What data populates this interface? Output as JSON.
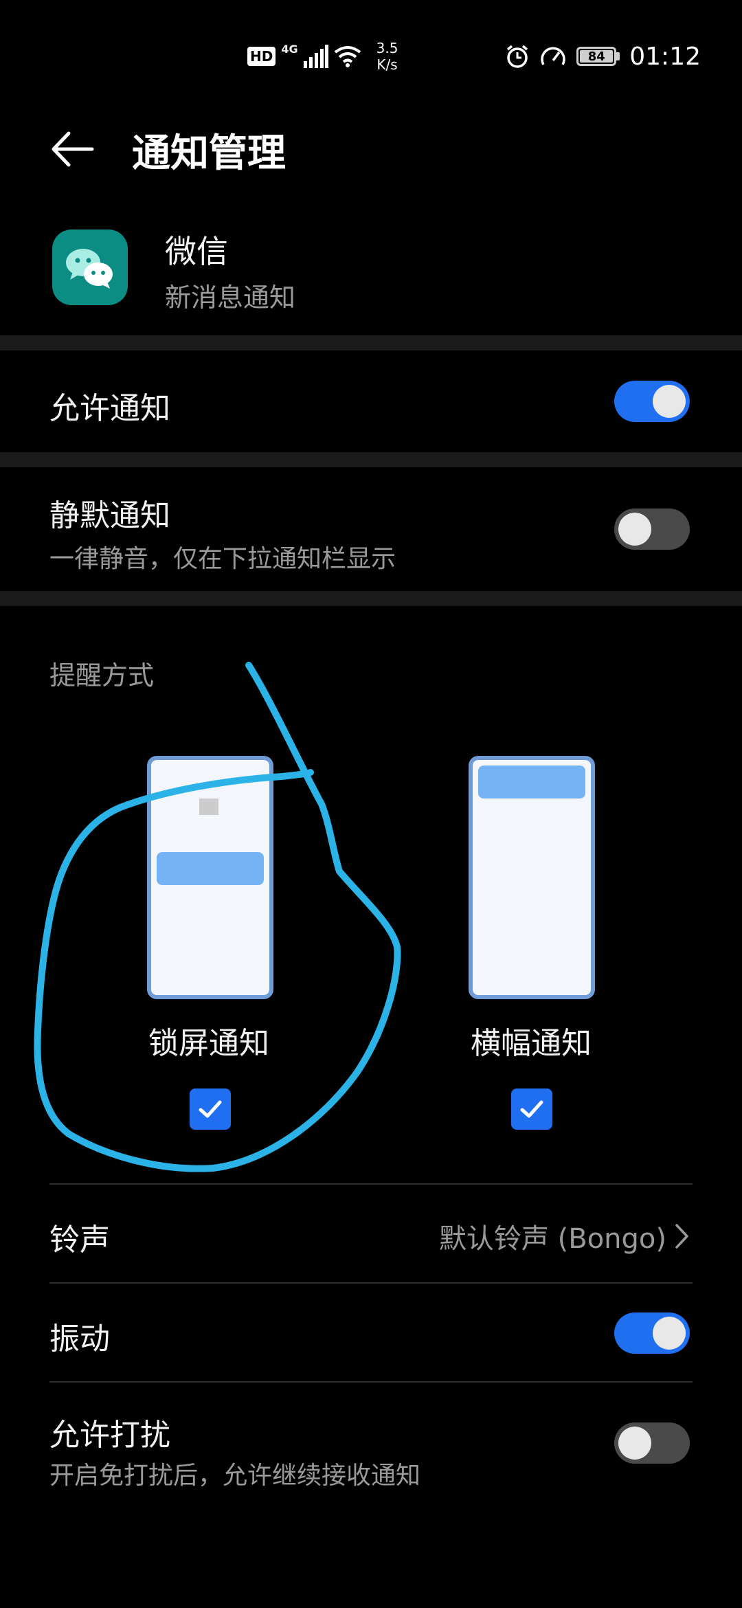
{
  "status_bar": {
    "hd": "HD",
    "network": "4G",
    "speed_value": "3.5",
    "speed_unit": "K/s",
    "battery": "84",
    "time": "01:12",
    "icons": [
      "hd-icon",
      "signal-icon",
      "wifi-icon",
      "alarm-icon",
      "speedometer-icon",
      "battery-icon"
    ]
  },
  "header": {
    "title": "通知管理"
  },
  "app": {
    "name": "微信",
    "subtitle": "新消息通知"
  },
  "allow_notifications": {
    "label": "允许通知",
    "enabled": true
  },
  "silent_notifications": {
    "label": "静默通知",
    "description": "一律静音，仅在下拉通知栏显示",
    "enabled": false
  },
  "reminder_section": {
    "label": "提醒方式",
    "options": [
      {
        "label": "锁屏通知",
        "checked": true
      },
      {
        "label": "横幅通知",
        "checked": true
      }
    ]
  },
  "ringtone": {
    "label": "铃声",
    "value": "默认铃声 (Bongo)"
  },
  "vibration": {
    "label": "振动",
    "enabled": true
  },
  "do_not_disturb": {
    "label": "允许打扰",
    "description": "开启免打扰后，允许继续接收通知",
    "enabled": false
  },
  "colors": {
    "accent": "#1f6ff0",
    "background": "#000000",
    "annotation": "#2bb3e8"
  }
}
